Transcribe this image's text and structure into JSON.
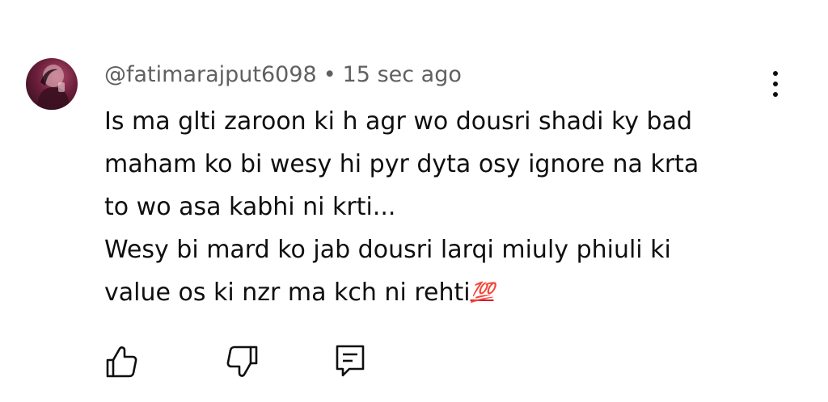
{
  "comment": {
    "author": "@fatimarajput6098",
    "separator": "•",
    "timestamp": "15 sec ago",
    "lines": [
      "Is ma glti zaroon ki h agr wo dousri shadi ky bad",
      "maham ko bi wesy hi pyr dyta osy ignore na krta",
      "to wo asa kabhi ni krti...",
      "Wesy bi mard ko jab dousri larqi miuly phiuli ki",
      "value os ki nzr ma kch ni rehti"
    ],
    "emoji": "💯",
    "emoji_icon": "hundred-points-icon"
  },
  "actions": {
    "like_icon": "thumbs-up-icon",
    "dislike_icon": "thumbs-down-icon",
    "reply_icon": "reply-comment-icon",
    "menu_icon": "more-vertical-icon"
  },
  "colors": {
    "text": "#0f0f0f",
    "meta": "#606060",
    "emoji_red": "#e1152b",
    "background": "#ffffff"
  }
}
